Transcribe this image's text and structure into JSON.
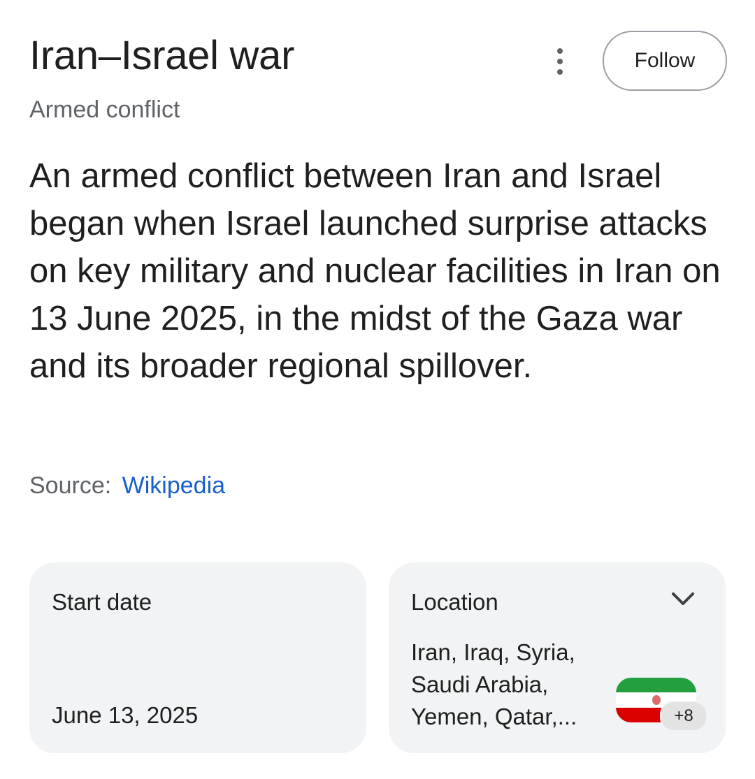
{
  "header": {
    "title": "Iran–Israel war",
    "subtitle": "Armed conflict",
    "follow_label": "Follow"
  },
  "description": "An armed conflict between Iran and Israel began when Israel launched surprise attacks on key military and nuclear facilities in Iran on 13 June 2025, in the midst of the Gaza war and its broader regional spillover.",
  "source": {
    "label": "Source:",
    "link_text": "Wikipedia"
  },
  "cards": {
    "start": {
      "label": "Start date",
      "value": "June 13, 2025"
    },
    "location": {
      "label": "Location",
      "value": "Iran, Iraq, Syria, Saudi Arabia, Yemen, Qatar,...",
      "more_count": "+8",
      "flag_icon": "iran-flag-icon",
      "expand_icon": "chevron-down-icon"
    }
  },
  "colors": {
    "link": "#1a5fc9",
    "card_bg": "#f1f3f4",
    "secondary_text": "#5f6368"
  }
}
